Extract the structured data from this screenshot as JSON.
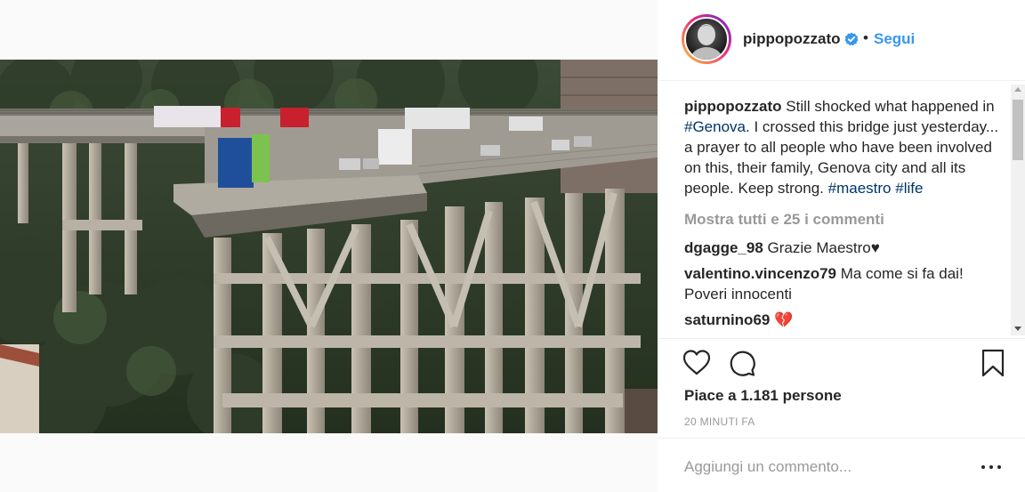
{
  "post": {
    "username": "pippopozzato",
    "separator": "•",
    "follow_label": "Segui",
    "caption": {
      "username": "pippopozzato",
      "text_before": " Still shocked what happened in ",
      "hashtag_genova": "#Genova",
      "text_after": ". I crossed this bridge just yesterday... a prayer to all people who have been involved on this, their family, Genova city and all its people. Keep strong. ",
      "hashtag_maestro": "#maestro",
      "space": " ",
      "hashtag_life": "#life"
    },
    "view_all_comments": "Mostra tutti e 25 i commenti",
    "comments": [
      {
        "username": "dgagge_98",
        "text": " Grazie Maestro♥"
      },
      {
        "username": "valentino.vincenzo79",
        "text": " Ma come si fa dai! Poveri innocenti"
      },
      {
        "username": "saturnino69",
        "text": " 💔"
      }
    ],
    "likes_prefix": "Piace a ",
    "likes_count": "1.181",
    "likes_suffix": " persone",
    "timestamp": "20 MINUTI FA",
    "comment_placeholder": "Aggiungi un commento..."
  },
  "icons": {
    "verified": "verified-badge-icon",
    "like": "heart-icon",
    "comment": "comment-bubble-icon",
    "save": "bookmark-icon",
    "more": "more-options-icon"
  },
  "colors": {
    "accent": "#3897f0",
    "hashtag": "#003569",
    "muted": "#999999",
    "text": "#262626"
  }
}
